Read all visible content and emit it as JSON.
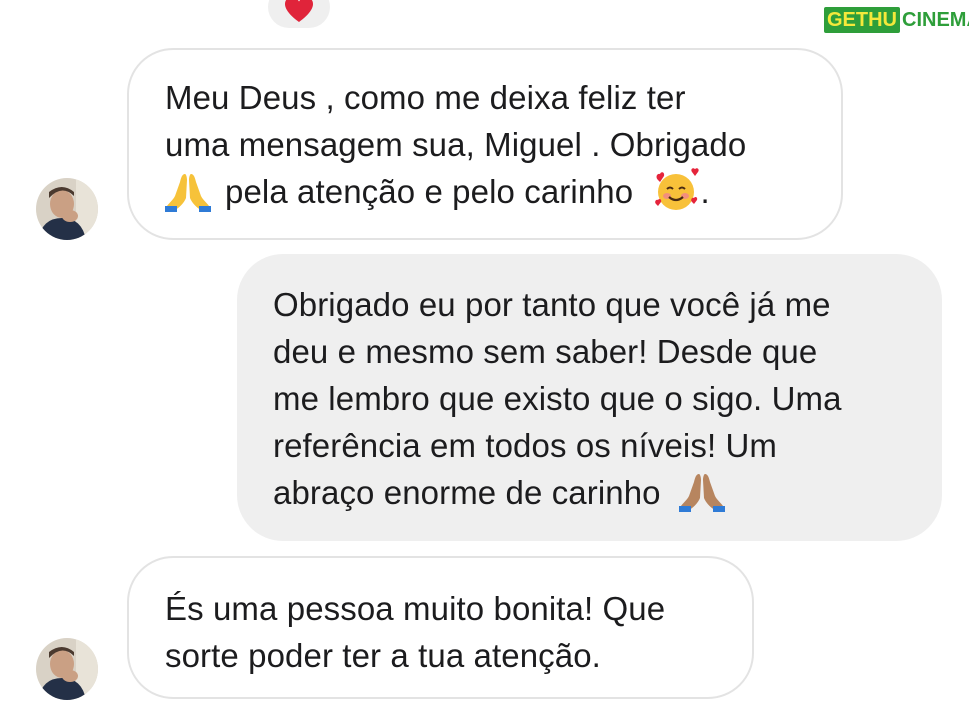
{
  "watermark": {
    "left": "GETHU",
    "right": "CINEMA"
  },
  "top_reaction": {
    "icon": "heart-icon",
    "color": "#e0243a"
  },
  "messages": [
    {
      "direction": "received",
      "lines": [
        "Meu Deus , como me deixa feliz ter",
        "uma mensagem sua, Miguel . Obrigado",
        "pela atenção e pelo carinho"
      ],
      "end_punctuation": ".",
      "emojis": [
        "folded-hands-icon",
        "smiling-face-with-hearts-icon"
      ]
    },
    {
      "direction": "sent",
      "lines": [
        "Obrigado eu por tanto que você já me",
        "deu e mesmo sem saber! Desde que",
        "me lembro que existo que o sigo. Uma",
        "referência em todos os níveis! Um",
        "abraço enorme de carinho"
      ],
      "emojis": [
        "folded-hands-icon"
      ]
    },
    {
      "direction": "received",
      "lines": [
        "És uma pessoa muito bonita! Que",
        "sorte poder ter a tua atenção."
      ]
    }
  ],
  "colors": {
    "received_bubble_border": "#e3e3e3",
    "sent_bubble_bg": "#efefef",
    "text": "#1c1c1e"
  }
}
